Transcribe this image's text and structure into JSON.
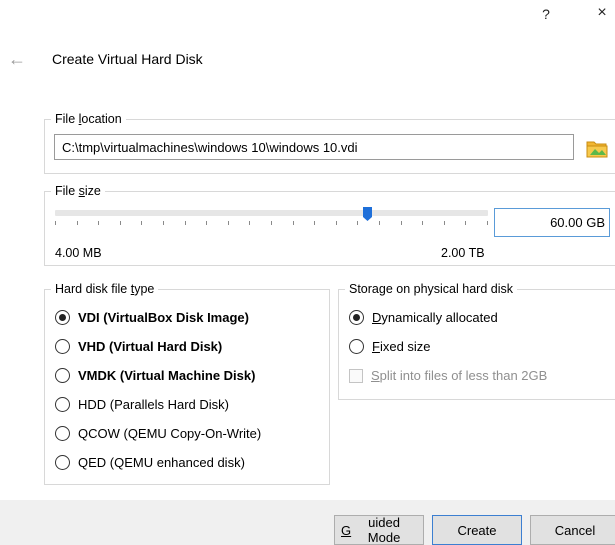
{
  "window": {
    "help_label": "?",
    "close_label": "×"
  },
  "header": {
    "back_icon": "back-arrow-icon",
    "title": "Create Virtual Hard Disk"
  },
  "file_location": {
    "legend_pre": "File ",
    "legend_u": "l",
    "legend_post": "ocation",
    "path": "C:\\tmp\\virtualmachines\\windows 10\\windows 10.vdi",
    "folder_icon": "folder-icon"
  },
  "file_size": {
    "legend_pre": "File ",
    "legend_u": "s",
    "legend_post": "ize",
    "value": "60.00 GB",
    "min_label": "4.00 MB",
    "max_label": "2.00 TB",
    "slider_fraction": 0.72
  },
  "disk_type": {
    "legend_pre": "Hard disk file ",
    "legend_u": "t",
    "legend_post": "ype",
    "options": [
      {
        "label": "VDI (VirtualBox Disk Image)",
        "checked": true,
        "bold": true
      },
      {
        "label": "VHD (Virtual Hard Disk)",
        "checked": false,
        "bold": true
      },
      {
        "label": "VMDK (Virtual Machine Disk)",
        "checked": false,
        "bold": true
      },
      {
        "label": "HDD (Parallels Hard Disk)",
        "checked": false,
        "bold": false
      },
      {
        "label": "QCOW (QEMU Copy-On-Write)",
        "checked": false,
        "bold": false
      },
      {
        "label": "QED (QEMU enhanced disk)",
        "checked": false,
        "bold": false
      }
    ]
  },
  "storage": {
    "legend": "Storage on physical hard disk",
    "dynamic_u": "D",
    "dynamic_rest": "ynamically allocated",
    "dynamic_checked": true,
    "fixed_u": "F",
    "fixed_rest": "ixed size",
    "fixed_checked": false,
    "split_u": "S",
    "split_rest": "plit into files of less than 2GB",
    "split_enabled": false
  },
  "footer": {
    "guided_u": "G",
    "guided_rest": "uided Mode",
    "create_label": "Create",
    "cancel_label": "Cancel"
  },
  "colors": {
    "accent": "#3c7fd1",
    "slider_thumb": "#1e6fd9",
    "folder_yellow": "#f2b632",
    "folder_green": "#5cb84a"
  }
}
